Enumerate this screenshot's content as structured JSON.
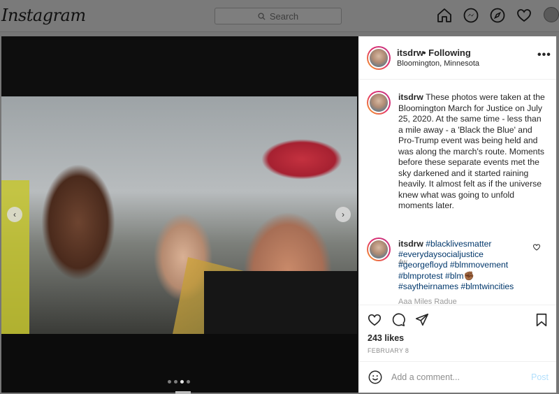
{
  "nav": {
    "logo": "Instagram",
    "search_placeholder": "Search"
  },
  "icons": {
    "home": "home-icon",
    "messenger": "messenger-icon",
    "explore": "compass-icon",
    "activity": "heart-icon",
    "profile": "avatar"
  },
  "post": {
    "username": "itsdrw",
    "follow_status": "• Following",
    "location": "Bloomington, Minnesota",
    "more": "•••",
    "carousel": {
      "total_slides": 4,
      "active_slide": 3
    },
    "caption": "These photos were taken at the Bloomington March for Justice on July 25, 2020. At the same time - less than a mile away - a 'Black the Blue' and Pro-Trump event was being held and was along the march's route. Moments before these separate events met the sky darkened and it started raining heavily. It almost felt as if the universe knew what was going to unfold moments later.",
    "caption_time": "4w",
    "hashtag_comment": {
      "username": "itsdrw",
      "line1": "#blacklivesmatter",
      "line2": "#everydaysocialjustice",
      "line3": "#georgefloyd #blmmovement",
      "line4a": "#blmprotest #blm",
      "line4_emoji": "✊🏾",
      "line5": "#saytheirnames #blmtwincities"
    },
    "faded_next": "Aaa Miles Radue",
    "likes": "243 likes",
    "date": "FEBRUARY 8",
    "comment_placeholder": "Add a comment...",
    "post_button": "Post"
  },
  "colors": {
    "overlay": "#767676",
    "link": "#00376b",
    "post_disabled": "#b2dffc",
    "story_ring": [
      "#f5a623",
      "#e1306c",
      "#c13584"
    ]
  }
}
